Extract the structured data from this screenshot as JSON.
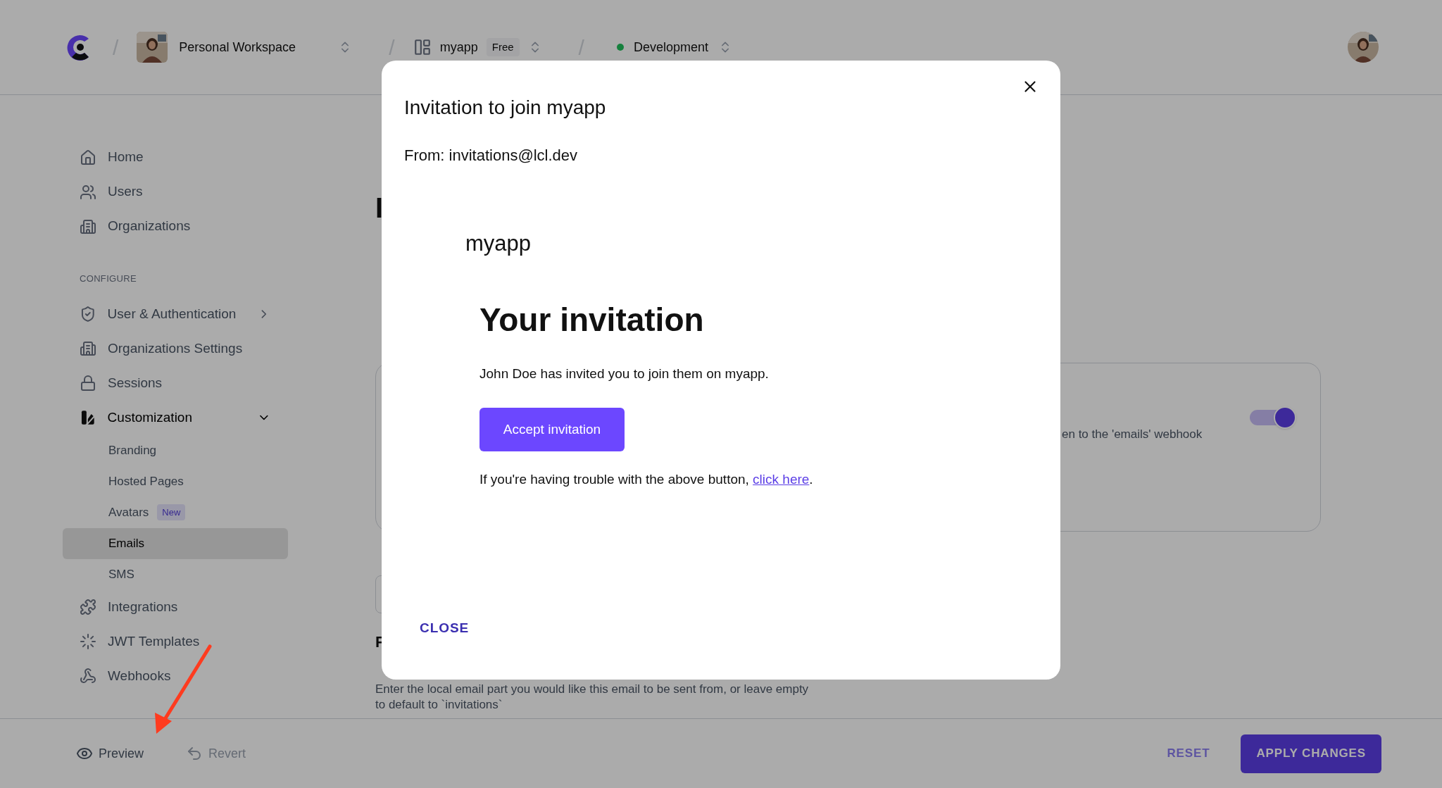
{
  "top_bar": {
    "separators": [
      "/",
      "/",
      "/"
    ],
    "workspace": {
      "name": "Personal Workspace"
    },
    "app": {
      "name": "myapp",
      "plan": "Free"
    },
    "environment": {
      "name": "Development",
      "color": "#15803d"
    }
  },
  "sidebar": {
    "items": [
      {
        "kind": "link",
        "label": "Home",
        "selected": false
      },
      {
        "kind": "link",
        "label": "Users",
        "selected": false
      },
      {
        "kind": "link",
        "label": "Organizations",
        "selected": false
      },
      {
        "kind": "section",
        "label": "CONFIGURE"
      },
      {
        "kind": "link",
        "label": "User & Authentication",
        "selected": false,
        "expanded": false
      },
      {
        "kind": "link",
        "label": "Organizations Settings",
        "selected": false
      },
      {
        "kind": "link",
        "label": "Sessions",
        "selected": false
      },
      {
        "kind": "link",
        "label": "Customization",
        "selected": false,
        "expanded": true,
        "children": [
          {
            "label": "Branding",
            "selected": false
          },
          {
            "label": "Hosted Pages",
            "selected": false
          },
          {
            "label": "Avatars",
            "badge": "New",
            "selected": false
          },
          {
            "label": "Emails",
            "selected": true
          },
          {
            "label": "SMS",
            "selected": false
          }
        ]
      },
      {
        "kind": "link",
        "label": "Integrations",
        "selected": false
      },
      {
        "kind": "link",
        "label": "JWT Templates",
        "selected": false
      },
      {
        "kind": "link",
        "label": "Webhooks",
        "selected": false
      }
    ]
  },
  "content": {
    "heading": "I",
    "card": {
      "text": "en to the 'emails' webhook",
      "toggle_on": true
    },
    "label_3": "F",
    "from_hint": "Enter the local email part you would like this email to be sent from, or leave empty to default to `invitations`"
  },
  "modal": {
    "title": "Invitation to join myapp",
    "from": "From: invitations@lcl.dev",
    "email": {
      "app_name": "myapp",
      "heading": "Your invitation",
      "body": "John Doe has invited you to join them on myapp.",
      "button": "Accept invitation",
      "trouble": "If you're having trouble with the above button,",
      "link": "click here",
      "trouble_end": "."
    },
    "close": "CLOSE"
  },
  "bottom_bar": {
    "preview": {
      "label": "Preview",
      "disabled": false
    },
    "revert": {
      "label": "Revert",
      "disabled": true
    },
    "reset": "RESET",
    "apply": "APPLY CHANGES"
  }
}
